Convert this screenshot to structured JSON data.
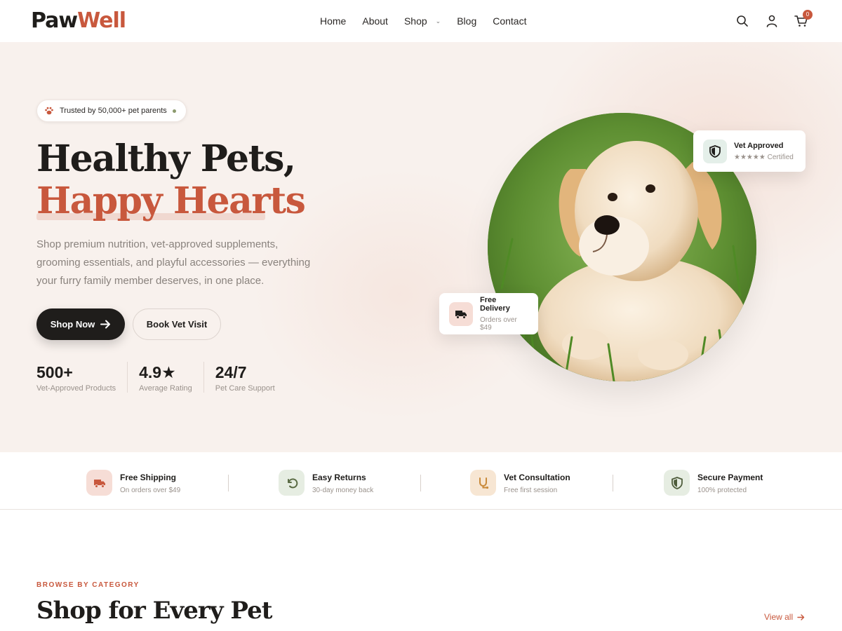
{
  "brand": {
    "name_part1": "Paw",
    "name_part2": "Well"
  },
  "nav": {
    "items": [
      {
        "label": "Home"
      },
      {
        "label": "About"
      },
      {
        "label": "Shop"
      },
      {
        "label": "Blog"
      },
      {
        "label": "Contact"
      }
    ]
  },
  "header_icons": {
    "search": "search-icon",
    "account": "user-icon",
    "cart": "cart-icon",
    "cart_count": "0"
  },
  "hero": {
    "trust_badge": "Trusted by 50,000+ pet parents",
    "title_line1": "Healthy Pets,",
    "title_line2": "Happy Hearts",
    "description": "Shop premium nutrition, vet-approved supplements, grooming essentials, and playful accessories — everything your furry family member deserves, in one place.",
    "primary_button": "Shop Now",
    "secondary_button": "Book Vet Visit",
    "stats": [
      {
        "value": "500+",
        "label": "Vet-Approved Products"
      },
      {
        "value": "4.9★",
        "label": "Average Rating"
      },
      {
        "value": "24/7",
        "label": "Pet Care Support"
      }
    ],
    "vet_card": {
      "title": "Vet Approved",
      "subtitle": "★★★★★ Certified"
    },
    "delivery_card": {
      "title": "Free Delivery",
      "subtitle": "Orders over $49"
    }
  },
  "features": [
    {
      "title": "Free Shipping",
      "subtitle": "On orders over $49",
      "icon": "truck-icon"
    },
    {
      "title": "Easy Returns",
      "subtitle": "30-day money back",
      "icon": "return-icon"
    },
    {
      "title": "Vet Consultation",
      "subtitle": "Free first session",
      "icon": "stethoscope-icon"
    },
    {
      "title": "Secure Payment",
      "subtitle": "100% protected",
      "icon": "shield-icon"
    }
  ],
  "categories": {
    "kicker": "BROWSE BY CATEGORY",
    "title": "Shop for Every Pet",
    "view_all": "View all"
  },
  "colors": {
    "accent": "#c8583d",
    "dark": "#1f1d1b",
    "hero_bg": "#f8f1ed"
  }
}
